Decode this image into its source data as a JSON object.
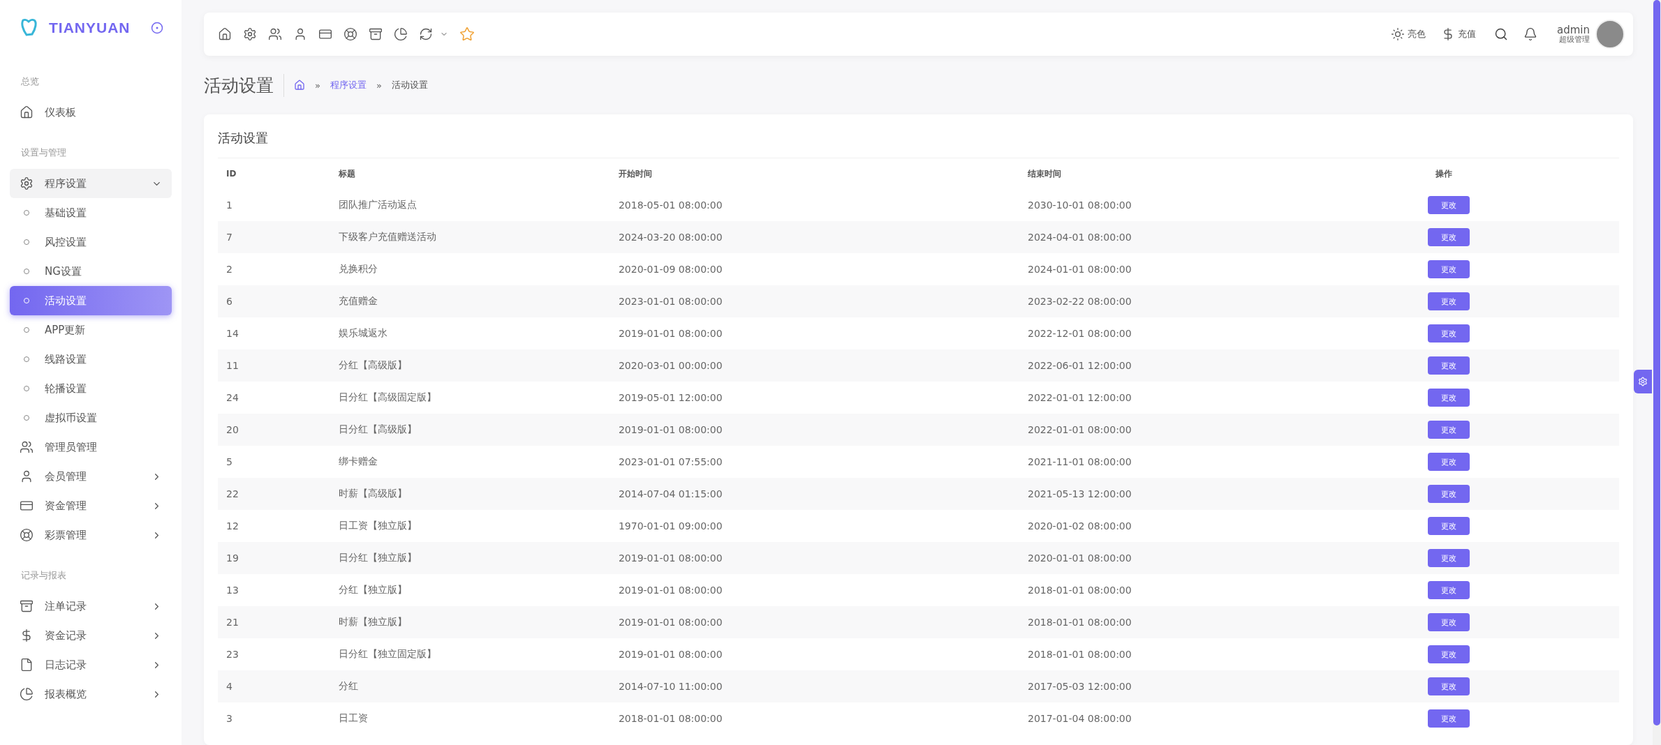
{
  "sidebar": {
    "brand": "TIANYUAN",
    "sections": [
      {
        "title": "总览",
        "items": [
          {
            "label": "仪表板",
            "kind": "link"
          }
        ]
      },
      {
        "title": "设置与管理",
        "items": [
          {
            "label": "程序设置",
            "kind": "group",
            "expanded": true,
            "children": [
              {
                "label": "基础设置",
                "selected": false
              },
              {
                "label": "风控设置",
                "selected": false
              },
              {
                "label": "NG设置",
                "selected": false
              },
              {
                "label": "活动设置",
                "selected": true
              },
              {
                "label": "APP更新",
                "selected": false
              },
              {
                "label": "线路设置",
                "selected": false
              },
              {
                "label": "轮播设置",
                "selected": false
              },
              {
                "label": "虚拟币设置",
                "selected": false
              }
            ]
          },
          {
            "label": "管理员管理",
            "kind": "link"
          },
          {
            "label": "会员管理",
            "kind": "group",
            "expanded": false
          },
          {
            "label": "资金管理",
            "kind": "group",
            "expanded": false
          },
          {
            "label": "彩票管理",
            "kind": "group",
            "expanded": false
          }
        ]
      },
      {
        "title": "记录与报表",
        "items": [
          {
            "label": "注单记录",
            "kind": "group",
            "expanded": false
          },
          {
            "label": "资金记录",
            "kind": "group",
            "expanded": false
          },
          {
            "label": "日志记录",
            "kind": "group",
            "expanded": false
          },
          {
            "label": "报表概览",
            "kind": "group",
            "expanded": false
          }
        ]
      }
    ]
  },
  "topbar": {
    "theme": "亮色",
    "recharge": "充值",
    "user": {
      "name": "admin",
      "role": "超级管理"
    }
  },
  "page": {
    "title": "活动设置",
    "breadcrumb": [
      "程序设置",
      "活动设置"
    ],
    "breadcrumb_separator": "»"
  },
  "card": {
    "title": "活动设置",
    "table": {
      "columns": [
        "ID",
        "标题",
        "开始时间",
        "结束时间",
        "操作"
      ],
      "rows": [
        {
          "id": "1",
          "title": "团队推广活动返点",
          "start": "2018-05-01 08:00:00",
          "end": "2030-10-01 08:00:00",
          "action": "更改"
        },
        {
          "id": "7",
          "title": "下级客户充值赠送活动",
          "start": "2024-03-20 08:00:00",
          "end": "2024-04-01 08:00:00",
          "action": "更改"
        },
        {
          "id": "2",
          "title": "兑换积分",
          "start": "2020-01-09 08:00:00",
          "end": "2024-01-01 08:00:00",
          "action": "更改"
        },
        {
          "id": "6",
          "title": "充值赠金",
          "start": "2023-01-01 08:00:00",
          "end": "2023-02-22 08:00:00",
          "action": "更改"
        },
        {
          "id": "14",
          "title": "娱乐城返水",
          "start": "2019-01-01 08:00:00",
          "end": "2022-12-01 08:00:00",
          "action": "更改"
        },
        {
          "id": "11",
          "title": "分红【高级版】",
          "start": "2020-03-01 00:00:00",
          "end": "2022-06-01 12:00:00",
          "action": "更改"
        },
        {
          "id": "24",
          "title": "日分红【高级固定版】",
          "start": "2019-05-01 12:00:00",
          "end": "2022-01-01 12:00:00",
          "action": "更改"
        },
        {
          "id": "20",
          "title": "日分红【高级版】",
          "start": "2019-01-01 08:00:00",
          "end": "2022-01-01 08:00:00",
          "action": "更改"
        },
        {
          "id": "5",
          "title": "绑卡赠金",
          "start": "2023-01-01 07:55:00",
          "end": "2021-11-01 08:00:00",
          "action": "更改"
        },
        {
          "id": "22",
          "title": "时薪【高级版】",
          "start": "2014-07-04 01:15:00",
          "end": "2021-05-13 12:00:00",
          "action": "更改"
        },
        {
          "id": "12",
          "title": "日工资【独立版】",
          "start": "1970-01-01 09:00:00",
          "end": "2020-01-02 08:00:00",
          "action": "更改"
        },
        {
          "id": "19",
          "title": "日分红【独立版】",
          "start": "2019-01-01 08:00:00",
          "end": "2020-01-01 08:00:00",
          "action": "更改"
        },
        {
          "id": "13",
          "title": "分红【独立版】",
          "start": "2019-01-01 08:00:00",
          "end": "2018-01-01 08:00:00",
          "action": "更改"
        },
        {
          "id": "21",
          "title": "时薪【独立版】",
          "start": "2019-01-01 08:00:00",
          "end": "2018-01-01 08:00:00",
          "action": "更改"
        },
        {
          "id": "23",
          "title": "日分红【独立固定版】",
          "start": "2019-01-01 08:00:00",
          "end": "2018-01-01 08:00:00",
          "action": "更改"
        },
        {
          "id": "4",
          "title": "分红",
          "start": "2014-07-10 11:00:00",
          "end": "2017-05-03 12:00:00",
          "action": "更改"
        },
        {
          "id": "3",
          "title": "日工资",
          "start": "2018-01-01 08:00:00",
          "end": "2017-01-04 08:00:00",
          "action": "更改"
        }
      ]
    }
  }
}
